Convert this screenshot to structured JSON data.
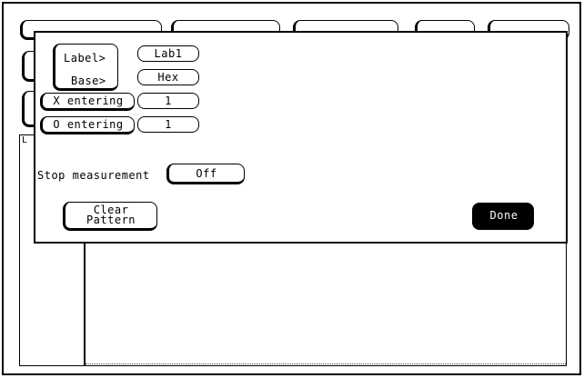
{
  "popup": {
    "label_key": "Label>",
    "base_key": "Base>",
    "label_value": "Lab1",
    "base_value": "Hex",
    "x_entering_label": "X entering",
    "x_entering_value": "1",
    "o_entering_label": "O entering",
    "o_entering_value": "1",
    "stop_measurement_label": "Stop measurement",
    "stop_measurement_value": "Off",
    "clear_pattern_line1": "Clear",
    "clear_pattern_line2": "Pattern",
    "done_label": "Done"
  }
}
